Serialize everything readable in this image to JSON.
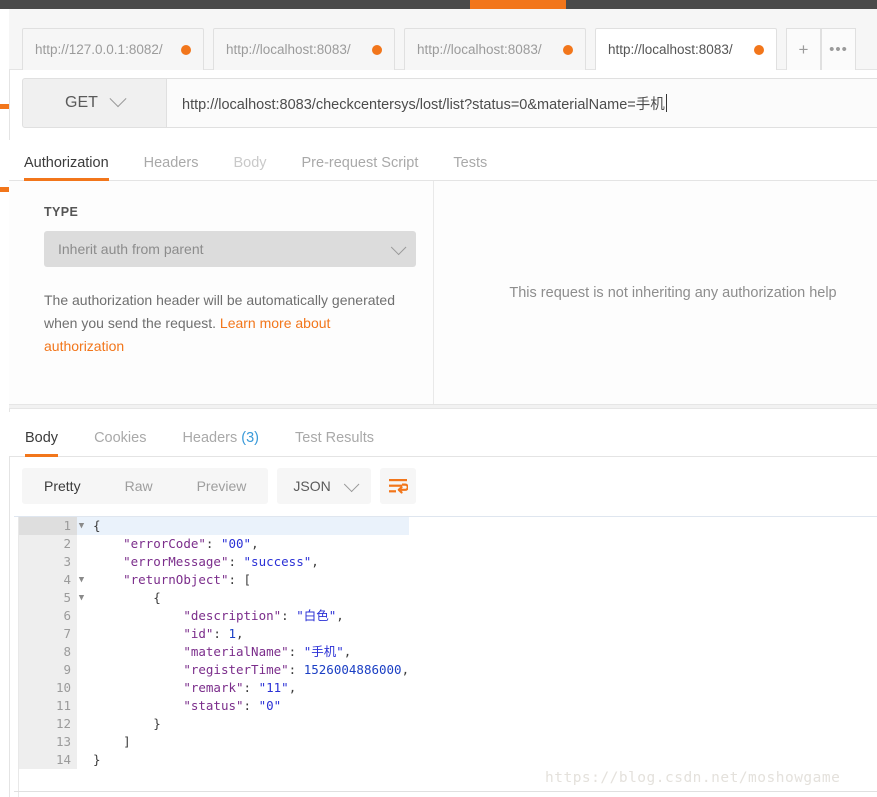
{
  "window": {
    "accent_color": "#f2761b",
    "top_strip_color": "#4a4a4a"
  },
  "tabbar": {
    "tabs": [
      {
        "label": "http://127.0.0.1:8082/",
        "active": false,
        "dot": "unsaved-dot"
      },
      {
        "label": "http://localhost:8083/",
        "active": false,
        "dot": "unsaved-dot"
      },
      {
        "label": "http://localhost:8083/",
        "active": false,
        "dot": "unsaved-dot"
      },
      {
        "label": "http://localhost:8083/",
        "active": true,
        "dot": "unsaved-dot"
      }
    ],
    "new_tab_label": "+",
    "more_label": "•••"
  },
  "request": {
    "method": "GET",
    "url": "http://localhost:8083/checkcentersys/lost/list?status=0&materialName=手机",
    "url_placeholder": "Enter request URL",
    "tabs": [
      {
        "label": "Authorization",
        "active": true,
        "dim": false
      },
      {
        "label": "Headers",
        "active": false,
        "dim": false
      },
      {
        "label": "Body",
        "active": false,
        "dim": true
      },
      {
        "label": "Pre-request Script",
        "active": false,
        "dim": false
      },
      {
        "label": "Tests",
        "active": false,
        "dim": false
      }
    ]
  },
  "authorization": {
    "type_label": "TYPE",
    "type_value": "Inherit auth from parent",
    "help_text": "The authorization header will be automatically generated when you send the request. ",
    "help_link": "Learn more about authorization",
    "right_note": "This request is not inheriting any authorization help"
  },
  "response": {
    "tabs": [
      {
        "label": "Body",
        "active": true,
        "count": ""
      },
      {
        "label": "Cookies",
        "active": false,
        "count": ""
      },
      {
        "label": "Headers",
        "active": false,
        "count": "(3)"
      },
      {
        "label": "Test Results",
        "active": false,
        "count": ""
      }
    ],
    "format_modes": [
      {
        "label": "Pretty",
        "active": true
      },
      {
        "label": "Raw",
        "active": false
      },
      {
        "label": "Preview",
        "active": false
      }
    ],
    "language": "JSON",
    "wrap_icon": "word-wrap-icon",
    "body_lines": [
      {
        "n": "1",
        "fold": true,
        "highlight": true,
        "indent": 0,
        "tokens": [
          {
            "t": "pun",
            "v": "{"
          }
        ]
      },
      {
        "n": "2",
        "fold": false,
        "highlight": false,
        "indent": 1,
        "tokens": [
          {
            "t": "key",
            "v": "\"errorCode\""
          },
          {
            "t": "pun",
            "v": ": "
          },
          {
            "t": "str",
            "v": "\"00\""
          },
          {
            "t": "pun",
            "v": ","
          }
        ]
      },
      {
        "n": "3",
        "fold": false,
        "highlight": false,
        "indent": 1,
        "tokens": [
          {
            "t": "key",
            "v": "\"errorMessage\""
          },
          {
            "t": "pun",
            "v": ": "
          },
          {
            "t": "str",
            "v": "\"success\""
          },
          {
            "t": "pun",
            "v": ","
          }
        ]
      },
      {
        "n": "4",
        "fold": true,
        "highlight": false,
        "indent": 1,
        "tokens": [
          {
            "t": "key",
            "v": "\"returnObject\""
          },
          {
            "t": "pun",
            "v": ": ["
          }
        ]
      },
      {
        "n": "5",
        "fold": true,
        "highlight": false,
        "indent": 2,
        "tokens": [
          {
            "t": "pun",
            "v": "{"
          }
        ]
      },
      {
        "n": "6",
        "fold": false,
        "highlight": false,
        "indent": 3,
        "tokens": [
          {
            "t": "key",
            "v": "\"description\""
          },
          {
            "t": "pun",
            "v": ": "
          },
          {
            "t": "str",
            "v": "\"白色\""
          },
          {
            "t": "pun",
            "v": ","
          }
        ]
      },
      {
        "n": "7",
        "fold": false,
        "highlight": false,
        "indent": 3,
        "tokens": [
          {
            "t": "key",
            "v": "\"id\""
          },
          {
            "t": "pun",
            "v": ": "
          },
          {
            "t": "num",
            "v": "1"
          },
          {
            "t": "pun",
            "v": ","
          }
        ]
      },
      {
        "n": "8",
        "fold": false,
        "highlight": false,
        "indent": 3,
        "tokens": [
          {
            "t": "key",
            "v": "\"materialName\""
          },
          {
            "t": "pun",
            "v": ": "
          },
          {
            "t": "str",
            "v": "\"手机\""
          },
          {
            "t": "pun",
            "v": ","
          }
        ]
      },
      {
        "n": "9",
        "fold": false,
        "highlight": false,
        "indent": 3,
        "tokens": [
          {
            "t": "key",
            "v": "\"registerTime\""
          },
          {
            "t": "pun",
            "v": ": "
          },
          {
            "t": "num",
            "v": "1526004886000"
          },
          {
            "t": "pun",
            "v": ","
          }
        ]
      },
      {
        "n": "10",
        "fold": false,
        "highlight": false,
        "indent": 3,
        "tokens": [
          {
            "t": "key",
            "v": "\"remark\""
          },
          {
            "t": "pun",
            "v": ": "
          },
          {
            "t": "str",
            "v": "\"11\""
          },
          {
            "t": "pun",
            "v": ","
          }
        ]
      },
      {
        "n": "11",
        "fold": false,
        "highlight": false,
        "indent": 3,
        "tokens": [
          {
            "t": "key",
            "v": "\"status\""
          },
          {
            "t": "pun",
            "v": ": "
          },
          {
            "t": "str",
            "v": "\"0\""
          }
        ]
      },
      {
        "n": "12",
        "fold": false,
        "highlight": false,
        "indent": 2,
        "tokens": [
          {
            "t": "pun",
            "v": "}"
          }
        ]
      },
      {
        "n": "13",
        "fold": false,
        "highlight": false,
        "indent": 1,
        "tokens": [
          {
            "t": "pun",
            "v": "]"
          }
        ]
      },
      {
        "n": "14",
        "fold": false,
        "highlight": false,
        "indent": 0,
        "tokens": [
          {
            "t": "pun",
            "v": "}"
          }
        ]
      }
    ]
  },
  "watermark": {
    "text": "https://blog.csdn.net/moshowgame"
  }
}
